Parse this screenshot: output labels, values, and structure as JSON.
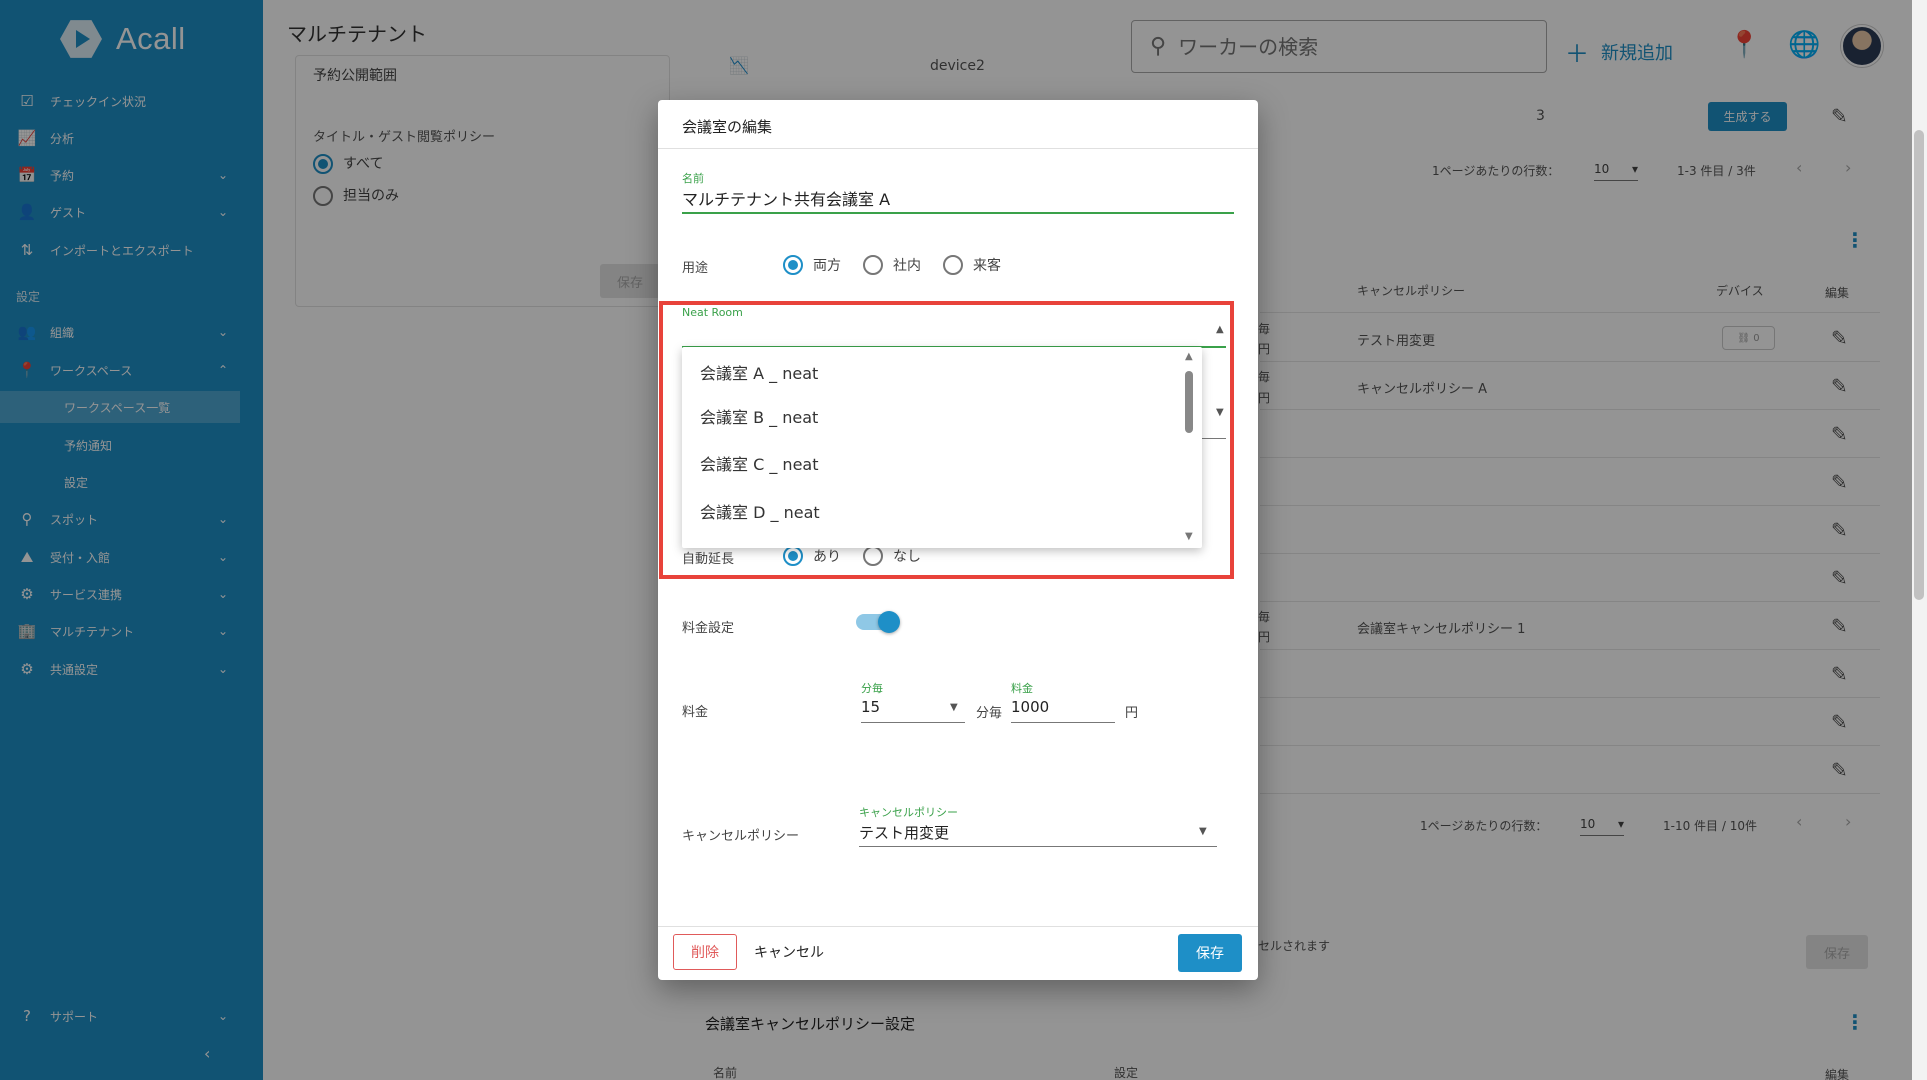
{
  "app": {
    "logo_text": "Acall",
    "page_title": "マルチテナント",
    "brand_color": "#1e8fc7",
    "highlight_color": "#e8423a"
  },
  "sidebar": {
    "items": [
      {
        "label": "チェックイン状況",
        "icon": "checkbox-icon"
      },
      {
        "label": "分析",
        "icon": "chart-icon"
      },
      {
        "label": "予約",
        "icon": "calendar-icon"
      },
      {
        "label": "ゲスト",
        "icon": "guest-icon"
      },
      {
        "label": "インポートとエクスポート",
        "icon": "import-export-icon"
      }
    ],
    "section_label": "設定",
    "settings_items": [
      {
        "label": "組織",
        "icon": "people-icon"
      },
      {
        "label": "ワークスペース",
        "icon": "location-pin-icon"
      }
    ],
    "workspace_sub": [
      {
        "label": "ワークスペース一覧"
      },
      {
        "label": "予約通知"
      },
      {
        "label": "設定"
      }
    ],
    "more_items": [
      {
        "label": "スポット",
        "icon": "spot-icon"
      },
      {
        "label": "受付・入館",
        "icon": "reception-icon"
      },
      {
        "label": "サービス連携",
        "icon": "integration-icon"
      },
      {
        "label": "マルチテナント",
        "icon": "building-icon"
      },
      {
        "label": "共通設定",
        "icon": "settings-icon"
      }
    ],
    "support_label": "サポート"
  },
  "topbar": {
    "search_placeholder": "ワーカーの検索",
    "add_new_label": "新規追加"
  },
  "background": {
    "card_title": "予約公開範囲",
    "policy_label": "タイトル・ゲスト閲覧ポリシー",
    "radio_all": "すべて",
    "radio_assignee": "担当のみ",
    "save_label": "保存",
    "device_name": "device2",
    "count_value": "3",
    "generate_button": "生成する",
    "rows_per_page_label": "1ページあたりの行数：",
    "rows_per_page_top": "10",
    "range_top": "1-3 件目 / 3件",
    "col_cancel_policy": "キャンセルポリシー",
    "col_device": "デバイス",
    "col_edit": "編集",
    "cell_test_change": "テスト用変更",
    "cell_policy_a": "キャンセルポリシー A",
    "cell_policy_1": "会議室キャンセルポリシー 1",
    "device_chip": "0",
    "per_label": "毎",
    "yen_label": "円",
    "rows_per_page_bottom": "10",
    "range_bottom": "1-10 件目 / 10件",
    "cancel_note": "セルされます",
    "section_title": "会議室キャンセルポリシー設定",
    "col_name": "名前",
    "col_setting": "設定",
    "col_edit2": "編集",
    "save_bottom": "保存"
  },
  "dialog": {
    "title": "会議室の編集",
    "name_caption": "名前",
    "name_value": "マルチテナント共有会議室 A",
    "purpose_label": "用途",
    "purpose_options": [
      "両方",
      "社内",
      "来客"
    ],
    "purpose_selected": "両方",
    "neat_caption": "Neat Room",
    "neat_options": [
      "会議室 A _ neat",
      "会議室 B _ neat",
      "会議室 C _ neat",
      "会議室 D _ neat"
    ],
    "auto_extend_label": "自動延長",
    "auto_extend_options": [
      "あり",
      "なし"
    ],
    "auto_extend_selected": "あり",
    "fee_setting_label": "料金設定",
    "fee_setting_on": true,
    "fee_label": "料金",
    "per_min_caption": "分毎",
    "per_min_value": "15",
    "per_min_suffix": "分毎",
    "fee_caption": "料金",
    "fee_value": "1000",
    "fee_suffix": "円",
    "cancel_policy_label": "キャンセルポリシー",
    "cancel_policy_caption": "キャンセルポリシー",
    "cancel_policy_value": "テスト用変更",
    "delete_button": "削除",
    "cancel_button": "キャンセル",
    "save_button": "保存"
  }
}
